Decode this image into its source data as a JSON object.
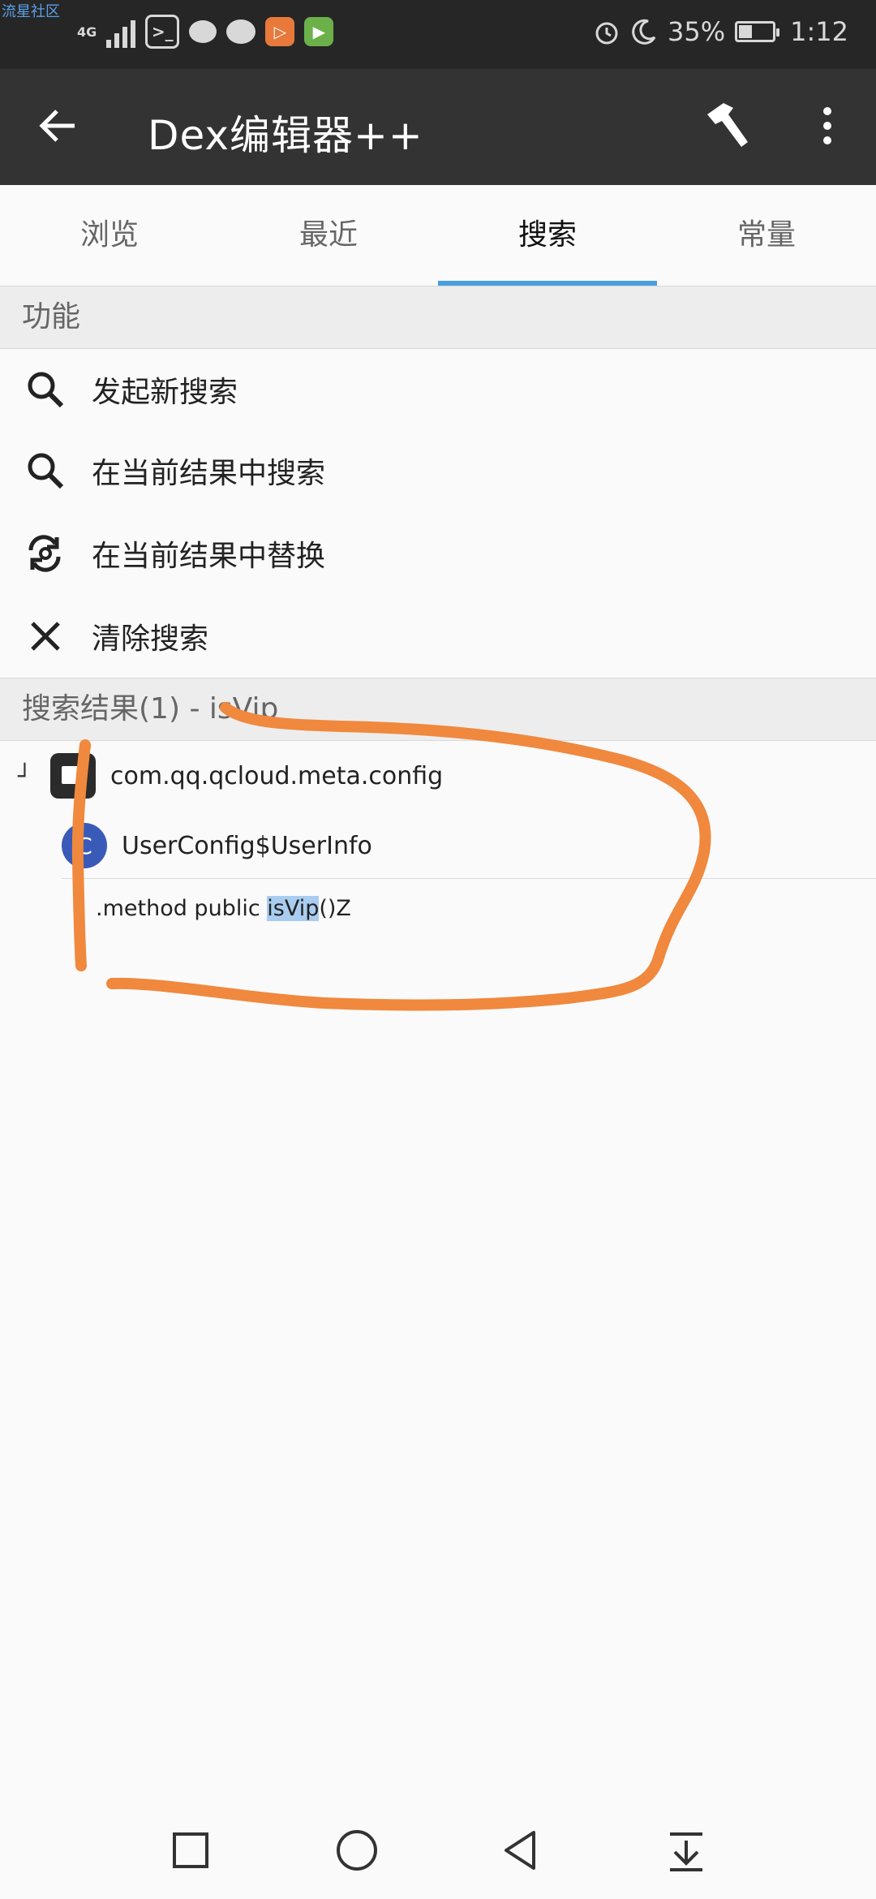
{
  "status_bar": {
    "watermark": "流星社区",
    "network": "4G",
    "battery_percent": "35%",
    "time": "1:12"
  },
  "app_bar": {
    "title": "Dex编辑器++"
  },
  "tabs": [
    {
      "label": "浏览",
      "active": false
    },
    {
      "label": "最近",
      "active": false
    },
    {
      "label": "搜索",
      "active": true
    },
    {
      "label": "常量",
      "active": false
    }
  ],
  "functions": {
    "header": "功能",
    "items": [
      {
        "label": "发起新搜索",
        "icon": "search-icon"
      },
      {
        "label": "在当前结果中搜索",
        "icon": "search-icon"
      },
      {
        "label": "在当前结果中替换",
        "icon": "replace-icon"
      },
      {
        "label": "清除搜索",
        "icon": "close-icon"
      }
    ]
  },
  "results": {
    "header": "搜索结果(1) - isVip",
    "package": "com.qq.qcloud.meta.config",
    "class_badge": "C",
    "class_name": "UserConfig$UserInfo",
    "method_prefix": ".method public ",
    "method_highlight": "isVip",
    "method_suffix": "()Z"
  },
  "colors": {
    "accent": "#4a9fe0",
    "appbar": "#333333",
    "annotation": "#f0883e"
  }
}
